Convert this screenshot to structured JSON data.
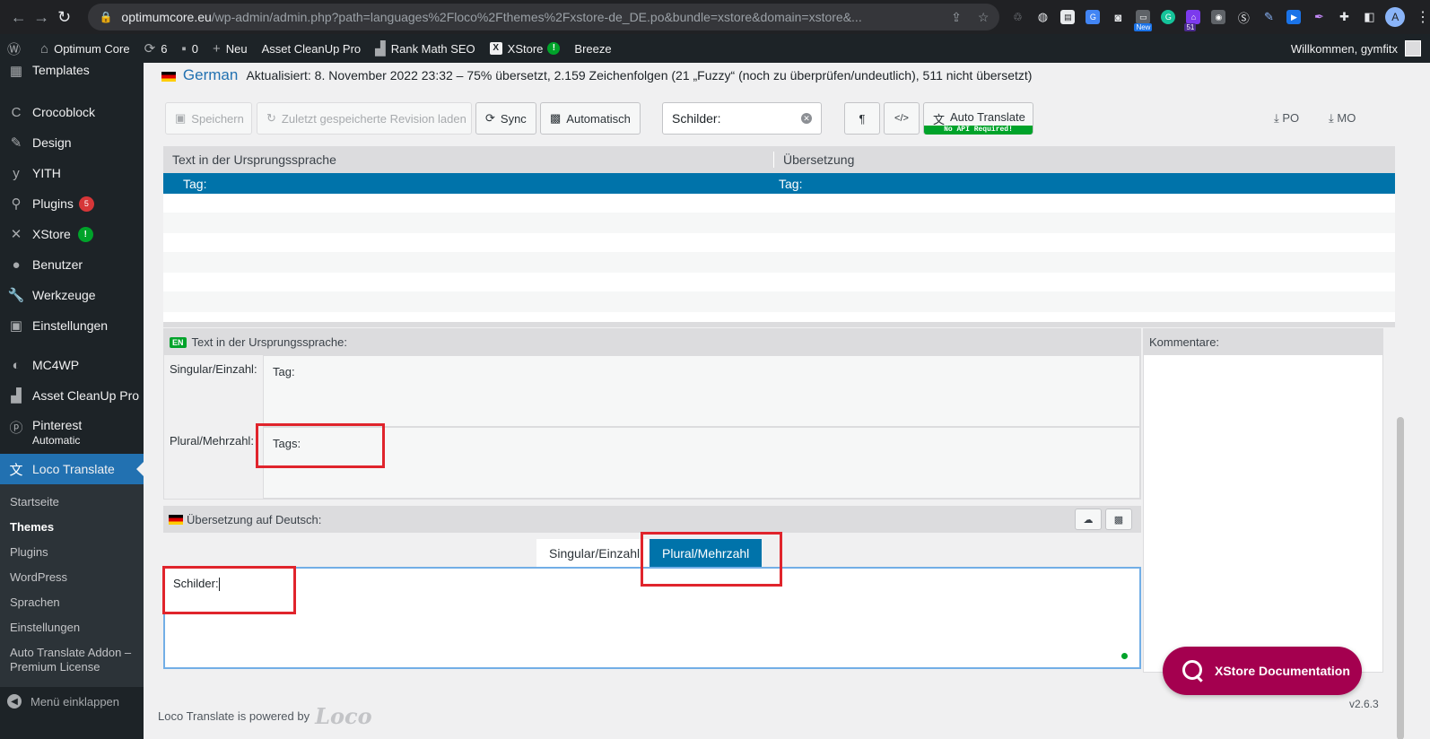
{
  "browser": {
    "url_host": "optimumcore.eu",
    "url_path": "/wp-admin/admin.php?path=languages%2Floco%2Fthemes%2Fxstore-de_DE.po&bundle=xstore&domain=xstore&...",
    "ext_new_badge": "New",
    "ext_count_badge": "51",
    "profile_letter": "A"
  },
  "adminbar": {
    "site_name": "Optimum Core",
    "updates_count": "6",
    "comments_count": "0",
    "new_label": "Neu",
    "asset_cleanup": "Asset CleanUp Pro",
    "rank_math": "Rank Math SEO",
    "xstore": "XStore",
    "breeze": "Breeze",
    "greeting": "Willkommen, gymfitx"
  },
  "sidebar": {
    "items": [
      {
        "label": "Templates",
        "icon": "templates-icon"
      },
      {
        "label": "Crocoblock",
        "icon": "crocoblock-icon"
      },
      {
        "label": "Design",
        "icon": "brush-icon"
      },
      {
        "label": "YITH",
        "icon": "yith-icon"
      },
      {
        "label": "Plugins",
        "icon": "plugin-icon",
        "count": "5"
      },
      {
        "label": "XStore",
        "icon": "xstore-icon",
        "badge": "!"
      },
      {
        "label": "Benutzer",
        "icon": "user-icon"
      },
      {
        "label": "Werkzeuge",
        "icon": "wrench-icon"
      },
      {
        "label": "Einstellungen",
        "icon": "settings-icon"
      },
      {
        "label": "MC4WP",
        "icon": "mc4wp-icon"
      },
      {
        "label": "Asset CleanUp Pro",
        "icon": "asset-cleanup-icon"
      },
      {
        "label": "Pinterest",
        "sub": "Automatic",
        "icon": "pinterest-icon"
      },
      {
        "label": "Loco Translate",
        "icon": "translate-icon"
      }
    ],
    "submenu": [
      "Startseite",
      "Themes",
      "Plugins",
      "WordPress",
      "Sprachen",
      "Einstellungen",
      "Auto Translate Addon – Premium License"
    ],
    "collapse_label": "Menü einklappen"
  },
  "header": {
    "language": "German",
    "status": "Aktualisiert: 8. November 2022 23:32 – 75% übersetzt, 2.159 Zeichenfolgen (21 „Fuzzy“ (noch zu überprüfen/undeutlich), 511 nicht übersetzt)"
  },
  "toolbar": {
    "save": "Speichern",
    "revert": "Zuletzt gespeicherte Revision laden",
    "sync": "Sync",
    "auto": "Automatisch",
    "search_value": "Schilder:",
    "pilcrow": "¶",
    "code": "</>",
    "auto_translate": "Auto Translate",
    "no_api": "No API Required!",
    "po": "PO",
    "mo": "MO"
  },
  "grid": {
    "col_source": "Text in der Ursprungssprache",
    "col_target": "Übersetzung",
    "selected_source": "Tag:",
    "selected_target": "Tag:"
  },
  "source_panel": {
    "lang_badge": "EN",
    "title": "Text in der Ursprungssprache:",
    "singular_label": "Singular/Einzahl:",
    "singular_value": "Tag:",
    "plural_label": "Plural/Mehrzahl:",
    "plural_value": "Tags:"
  },
  "comments": {
    "title": "Kommentare:"
  },
  "target_panel": {
    "title": "Übersetzung auf Deutsch:",
    "tab_singular": "Singular/Einzahl",
    "tab_plural": "Plural/Mehrzahl",
    "value": "Schilder:"
  },
  "footer": {
    "powered": "Loco Translate is powered by",
    "logo": "Loco",
    "version": "v2.6.3",
    "xstore_docs": "XStore Documentation"
  }
}
